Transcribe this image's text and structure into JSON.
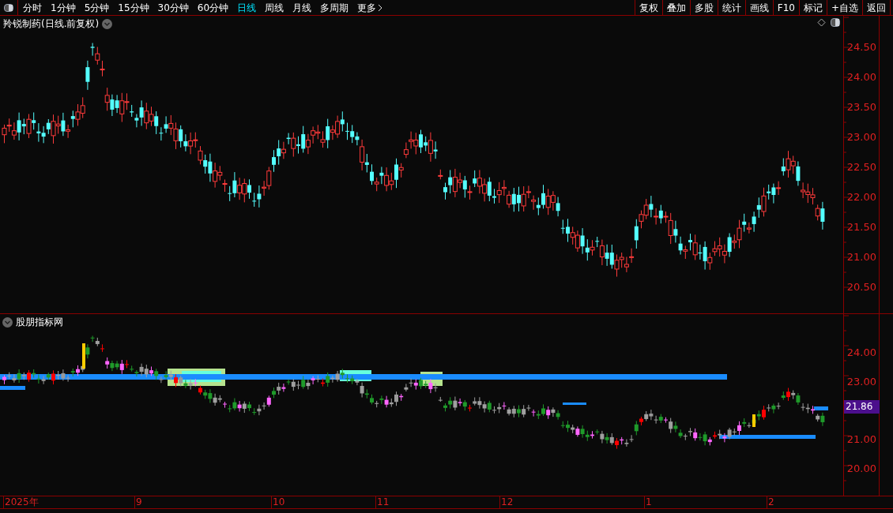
{
  "toolbar": {
    "periods": [
      {
        "label": "分时",
        "selected": false
      },
      {
        "label": "1分钟",
        "selected": false
      },
      {
        "label": "5分钟",
        "selected": false
      },
      {
        "label": "15分钟",
        "selected": false
      },
      {
        "label": "30分钟",
        "selected": false
      },
      {
        "label": "60分钟",
        "selected": false
      },
      {
        "label": "日线",
        "selected": true
      },
      {
        "label": "周线",
        "selected": false
      },
      {
        "label": "月线",
        "selected": false
      },
      {
        "label": "多周期",
        "selected": false
      }
    ],
    "more": "更多",
    "buttons": [
      "复权",
      "叠加",
      "多股",
      "统计",
      "画线",
      "F10",
      "标记",
      "+自选",
      "返回"
    ]
  },
  "main_panel": {
    "title": "羚锐制药(日线.前复权)",
    "price_axis": [
      "24.50",
      "24.00",
      "23.50",
      "23.00",
      "22.50",
      "22.00",
      "21.50",
      "21.00",
      "20.50"
    ]
  },
  "indicator_panel": {
    "title": "股朋指标网",
    "price_axis": [
      "24.00",
      "23.00",
      "21.00",
      "20.00"
    ],
    "last_price": "21.86"
  },
  "date_axis": [
    "2025年",
    "9",
    "10",
    "11",
    "12",
    "1",
    "2"
  ]
}
